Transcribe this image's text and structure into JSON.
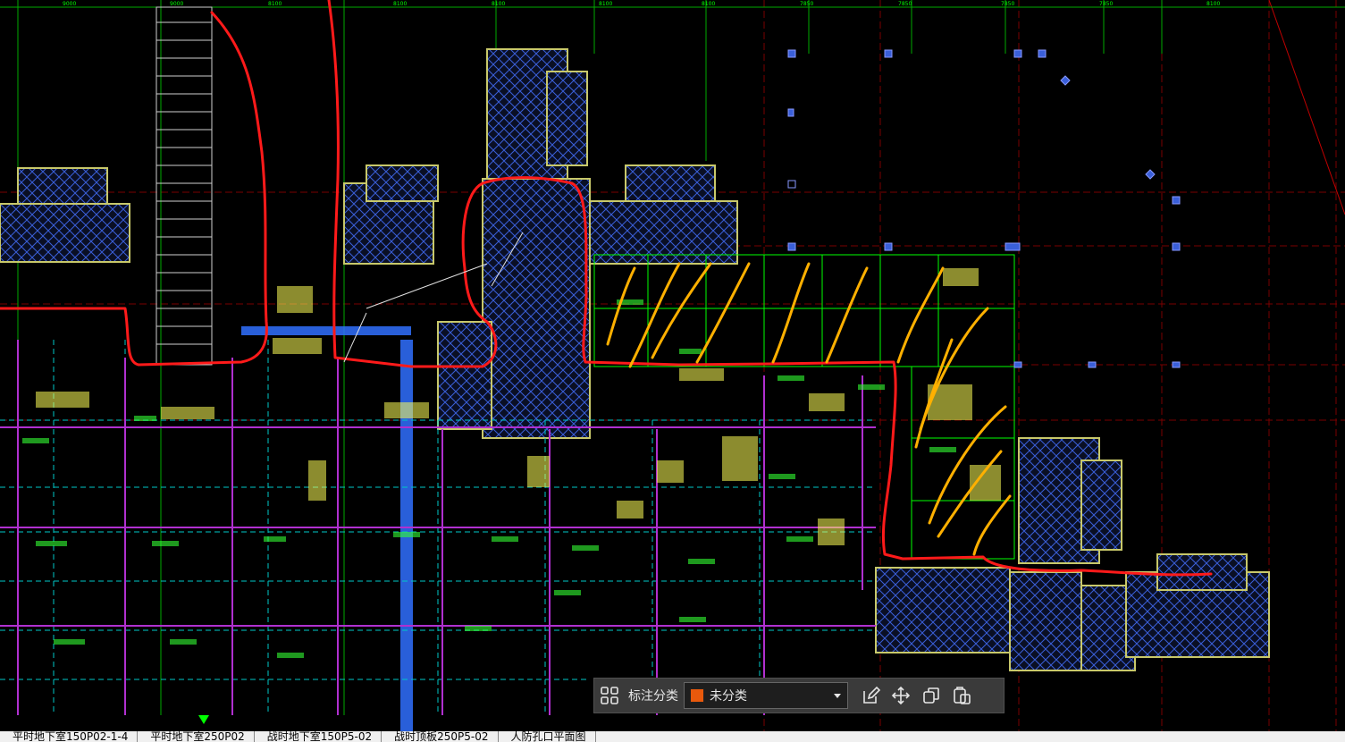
{
  "toolbar": {
    "category_label": "标注分类",
    "category_value": "未分类",
    "category_color": "#e8590c",
    "icons": [
      "grid-icon",
      "chevron-down-icon",
      "edit-icon",
      "move-icon",
      "copy-icon",
      "paste-icon"
    ]
  },
  "layout_tabs": [
    "平时地下室150P02-1-4",
    "平时地下室250P02",
    "战时地下室150P5-02",
    "战时顶板250P5-02",
    "人防孔口平面图"
  ],
  "colors": {
    "background": "#000000",
    "hatch": "#3a5fd9",
    "wall_outline": "#c8c86a",
    "cyan_line": "#00c8c8",
    "green_line": "#00ff00",
    "magenta_line": "#b030d0",
    "dark_red_grid": "#7a0000",
    "red_markup": "#ff1a1a",
    "orange_markup": "#ffb000",
    "blue_column": "#3070ff",
    "text_yellow": "#ffff55",
    "text_green": "#33ff33"
  }
}
